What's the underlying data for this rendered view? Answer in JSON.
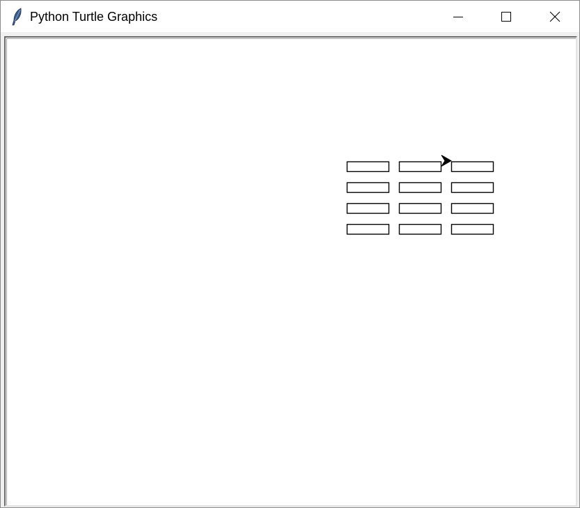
{
  "window": {
    "title": "Python Turtle Graphics",
    "app_icon": "feather-icon",
    "controls": {
      "minimize": "minimize-icon",
      "maximize": "maximize-icon",
      "close": "close-icon"
    }
  },
  "canvas": {
    "background_color": "#ffffff",
    "stroke_color": "#000000",
    "brick_grid": {
      "rows": 4,
      "columns": 3
    },
    "turtle": {
      "shape": "arrow-icon",
      "heading": "east",
      "color": "#000000"
    }
  }
}
